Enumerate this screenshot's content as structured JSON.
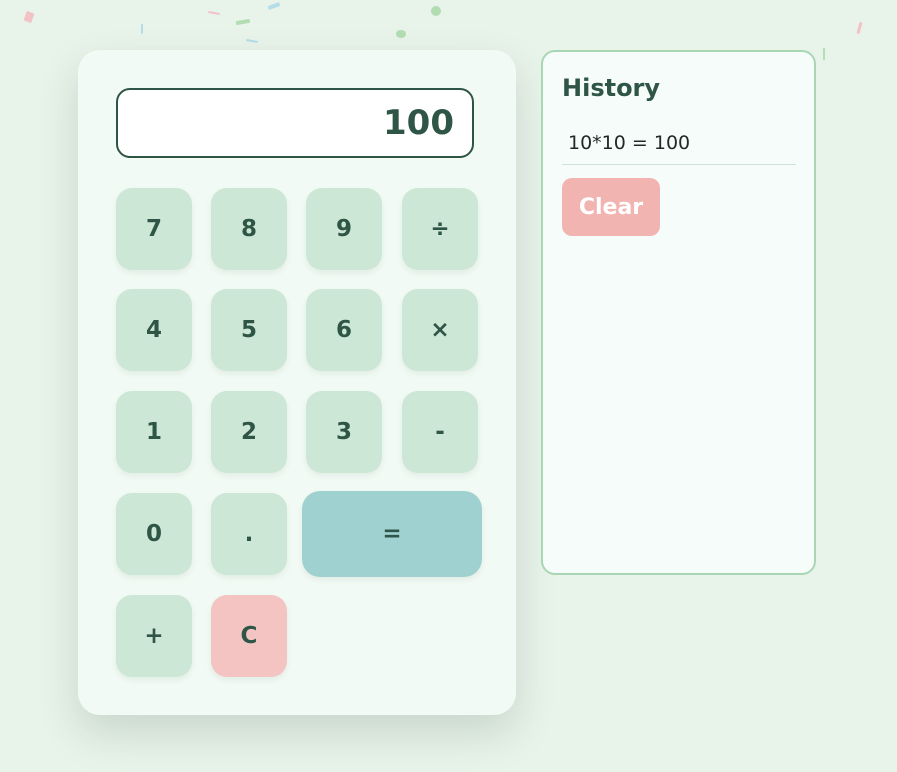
{
  "display": {
    "value": "100"
  },
  "keys": {
    "k7": "7",
    "k8": "8",
    "k9": "9",
    "div": "÷",
    "k4": "4",
    "k5": "5",
    "k6": "6",
    "mul": "×",
    "k1": "1",
    "k2": "2",
    "k3": "3",
    "sub": "-",
    "k0": "0",
    "dot": ".",
    "eq": "=",
    "add": "+",
    "clear": "C"
  },
  "history": {
    "title": "History",
    "entries": [
      "10*10 = 100"
    ],
    "clear_label": "Clear"
  },
  "colors": {
    "background": "#e8f3ea",
    "key": "#cde7d6",
    "equals": "#9fd1d1",
    "clear_key": "#f3c4c2",
    "clear_button": "#f1b4b0",
    "text": "#2f5546"
  }
}
